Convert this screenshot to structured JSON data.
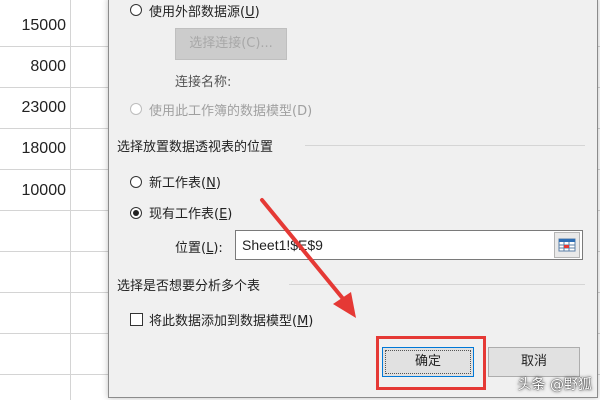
{
  "sheet": {
    "values": [
      "15000",
      "8000",
      "23000",
      "18000",
      "10000"
    ]
  },
  "dialog": {
    "external_source": {
      "label": "使用外部数据源(",
      "hotkey": "U",
      "suffix": ")"
    },
    "choose_connection_label": "选择连接(C)...",
    "connection_name_label": "连接名称:",
    "data_model": {
      "label": "使用此工作簿的数据模型(D)"
    },
    "placement_section_title": "选择放置数据透视表的位置",
    "new_worksheet": {
      "label": "新工作表(",
      "hotkey": "N",
      "suffix": ")"
    },
    "existing_worksheet": {
      "label": "现有工作表(",
      "hotkey": "E",
      "suffix": ")"
    },
    "location": {
      "label": "位置(",
      "hotkey": "L",
      "suffix": "):",
      "value": "Sheet1!$E$9"
    },
    "analyze_section_title": "选择是否想要分析多个表",
    "add_to_data_model": {
      "label": "将此数据添加到数据模型(",
      "hotkey": "M",
      "suffix": ")"
    },
    "ok_label": "确定",
    "cancel_label": "取消"
  },
  "watermark": "头条 @野狐",
  "colors": {
    "highlight": "#e53935",
    "arrow": "#e53935",
    "dialog_bg": "#f0f0f0"
  },
  "icons": {
    "range_picker": "range-selector-icon"
  }
}
